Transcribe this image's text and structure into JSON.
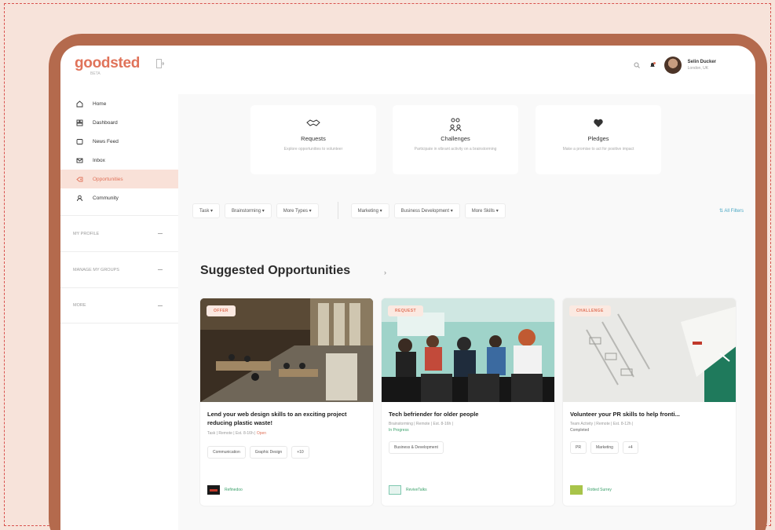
{
  "app": {
    "logo": "goodsted",
    "logo_sub": "BETA"
  },
  "header": {
    "user_name": "Selin Ducker",
    "user_location": "London, UK"
  },
  "sidebar": {
    "items": [
      {
        "label": "Home",
        "icon": "home-icon"
      },
      {
        "label": "Dashboard",
        "icon": "dashboard-icon"
      },
      {
        "label": "News Feed",
        "icon": "news-feed-icon"
      },
      {
        "label": "Inbox",
        "icon": "inbox-icon"
      },
      {
        "label": "Opportunities",
        "icon": "opportunities-icon",
        "active": true
      },
      {
        "label": "Community",
        "icon": "community-icon"
      }
    ],
    "sections": [
      "MY PROFILE",
      "MANAGE MY GROUPS",
      "MORE"
    ]
  },
  "categories": [
    {
      "title": "Requests",
      "desc": "Explore opportunities to volunteer",
      "icon": "handshake-icon"
    },
    {
      "title": "Challenges",
      "desc": "Participate in vibrant activity on a brainstorming",
      "icon": "team-icon"
    },
    {
      "title": "Pledges",
      "desc": "Make a promise to act for positive impact",
      "icon": "heart-hand-icon"
    }
  ],
  "filters": {
    "type_chips": [
      "Task ▾",
      "Brainstorming ▾",
      "More Types ▾"
    ],
    "skill_chips": [
      "Marketing ▾",
      "Business Development ▾",
      "More Skills ▾"
    ],
    "all_filters": "⇅ All Filters"
  },
  "section": {
    "title": "Suggested Opportunities",
    "arrow": "›"
  },
  "cards": [
    {
      "badge": "OFFER",
      "title": "Lend your web design skills to an exciting project reducing plastic waste!",
      "meta": "Task | Remote | Est. 8-16h | ",
      "meta_highlight": "Open",
      "status": "",
      "tags": [
        "Communication",
        "Graphic Design",
        "+10"
      ],
      "org": "Refinedoo",
      "org_color": "#c0392b"
    },
    {
      "badge": "REQUEST",
      "title": "Tech befriender for older people",
      "meta": "Brainstorming | Remote | Est. 8-16h |",
      "meta_highlight": "",
      "status": "In Progress",
      "status_color": "#3aa06a",
      "tags": [
        "Business & Development"
      ],
      "org": "ReviveTalks",
      "org_color": "#7fc8b0"
    },
    {
      "badge": "CHALLENGE",
      "title": "Volunteer your PR skills to help fronti...",
      "meta": "Team Activity | Remote | Est. 8-12h |",
      "meta_highlight": "",
      "status": "Completed",
      "status_color": "#666666",
      "tags": [
        "PR",
        "Marketing",
        "+4"
      ],
      "org": "Rotted Surrey",
      "org_color": "#a8c44a"
    }
  ]
}
